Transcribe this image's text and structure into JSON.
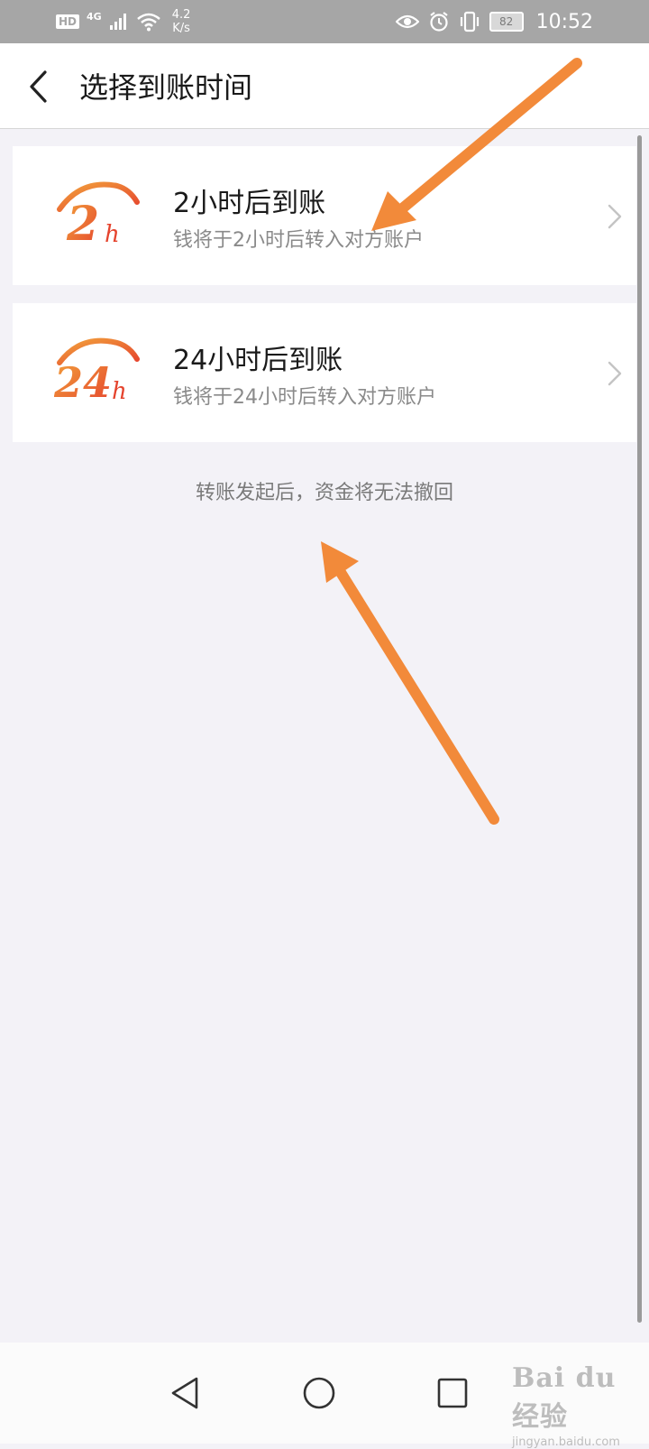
{
  "status_bar": {
    "hd": "HD",
    "network": "4G",
    "speed_value": "4.2",
    "speed_unit": "K/s",
    "battery": "82",
    "time": "10:52"
  },
  "header": {
    "title": "选择到账时间"
  },
  "options": [
    {
      "logo_number": "2",
      "logo_unit": "h",
      "title": "2小时后到账",
      "subtitle": "钱将于2小时后转入对方账户"
    },
    {
      "logo_number": "24",
      "logo_unit": "h",
      "title": "24小时后到账",
      "subtitle": "钱将于24小时后转入对方账户"
    }
  ],
  "notice": "转账发起后，资金将无法撤回",
  "watermark": {
    "logo_text": "Bai du 经验",
    "url": "jingyan.baidu.com"
  },
  "colors": {
    "accent_orange": "#f08a3c",
    "logo_red": "#e8442e",
    "logo_orange": "#f39a3a",
    "background": "#f3f2f7"
  }
}
